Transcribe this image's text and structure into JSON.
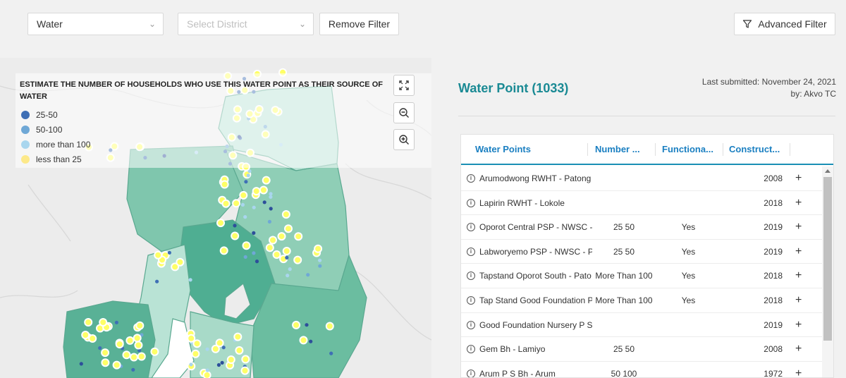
{
  "filters": {
    "category_value": "Water",
    "district_placeholder": "Select District",
    "remove_label": "Remove Filter",
    "advanced_label": "Advanced Filter"
  },
  "map": {
    "legend_title": "ESTIMATE THE NUMBER OF HOUSEHOLDS WHO USE THIS WATER POINT AS THEIR SOURCE OF WATER",
    "legend": [
      {
        "label": "25-50",
        "color": "#3f6fb5"
      },
      {
        "label": "50-100",
        "color": "#6fa8d6"
      },
      {
        "label": "more than 100",
        "color": "#a9d6ee"
      },
      {
        "label": "less than 25",
        "color": "#fde98a"
      }
    ],
    "icons": [
      "fullscreen-icon",
      "zoom-out-icon",
      "zoom-in-icon"
    ]
  },
  "panel": {
    "title": "Water Point (1033)",
    "submitted_line1": "Last submitted: November 24, 2021",
    "submitted_line2": "by: Akvo TC",
    "accent_color": "#1a8a94"
  },
  "table": {
    "headers": [
      "Water Points",
      "Number ...",
      "Functiona...",
      "Construct..."
    ],
    "rows": [
      {
        "name": "Arumodwong RWHT - Patong",
        "number": "",
        "functional": "",
        "year": "2008"
      },
      {
        "name": "Lapirin RWHT - Lokole",
        "number": "",
        "functional": "",
        "year": "2018"
      },
      {
        "name": "Oporot Central PSP - NWSC -",
        "number": "25 50",
        "functional": "Yes",
        "year": "2019"
      },
      {
        "name": "Labworyemo PSP - NWSC - Pa",
        "number": "25 50",
        "functional": "Yes",
        "year": "2019"
      },
      {
        "name": "Tapstand Oporot South - Pato",
        "number": "More Than 100",
        "functional": "Yes",
        "year": "2018"
      },
      {
        "name": "Tap Stand Good Foundation P",
        "number": "More Than 100",
        "functional": "Yes",
        "year": "2018"
      },
      {
        "name": "Good Foundation Nursery P S",
        "number": "",
        "functional": "",
        "year": "2019"
      },
      {
        "name": "Gem Bh - Lamiyo",
        "number": "25 50",
        "functional": "",
        "year": "2008"
      },
      {
        "name": "Arum P S Bh - Arum",
        "number": "50 100",
        "functional": "",
        "year": "1972"
      }
    ]
  }
}
